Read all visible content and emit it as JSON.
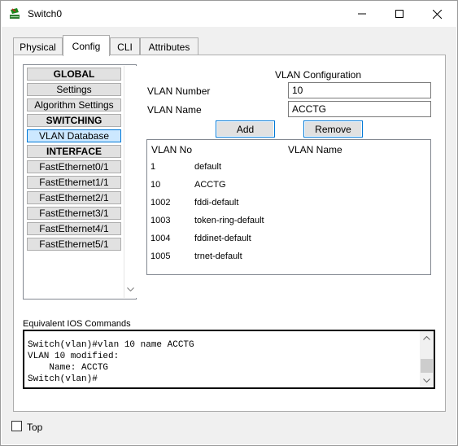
{
  "window": {
    "title": "Switch0",
    "icon": "switch-app-icon",
    "controls": [
      "minimize-icon",
      "maximize-icon",
      "close-icon"
    ]
  },
  "tabs": [
    {
      "label": "Physical",
      "active": false
    },
    {
      "label": "Config",
      "active": true
    },
    {
      "label": "CLI",
      "active": false
    },
    {
      "label": "Attributes",
      "active": false
    }
  ],
  "sidebar": {
    "items": [
      {
        "label": "GLOBAL",
        "header": true
      },
      {
        "label": "Settings"
      },
      {
        "label": "Algorithm Settings"
      },
      {
        "label": "SWITCHING",
        "header": true
      },
      {
        "label": "VLAN Database",
        "selected": true
      },
      {
        "label": "INTERFACE",
        "header": true
      },
      {
        "label": "FastEthernet0/1"
      },
      {
        "label": "FastEthernet1/1"
      },
      {
        "label": "FastEthernet2/1"
      },
      {
        "label": "FastEthernet3/1"
      },
      {
        "label": "FastEthernet4/1"
      },
      {
        "label": "FastEthernet5/1"
      }
    ]
  },
  "vlan_config": {
    "title": "VLAN Configuration",
    "number_label": "VLAN Number",
    "number_value": "10",
    "name_label": "VLAN Name",
    "name_value": "ACCTG",
    "add_label": "Add",
    "remove_label": "Remove",
    "table": {
      "headers": [
        "VLAN No",
        "VLAN Name"
      ],
      "rows": [
        [
          "1",
          "default"
        ],
        [
          "10",
          "ACCTG"
        ],
        [
          "1002",
          "fddi-default"
        ],
        [
          "1003",
          "token-ring-default"
        ],
        [
          "1004",
          "fddinet-default"
        ],
        [
          "1005",
          "trnet-default"
        ]
      ]
    }
  },
  "ios": {
    "label": "Equivalent IOS Commands",
    "lines": [
      "Switch(vlan)#vlan 10 name ACCTG",
      "VLAN 10 modified:",
      "    Name: ACCTG",
      "Switch(vlan)#"
    ]
  },
  "footer": {
    "top_label": "Top",
    "top_checked": false
  },
  "colors": {
    "selection_bg": "#cce8ff",
    "selection_border": "#0078d7",
    "button_border": "#0078d7"
  }
}
